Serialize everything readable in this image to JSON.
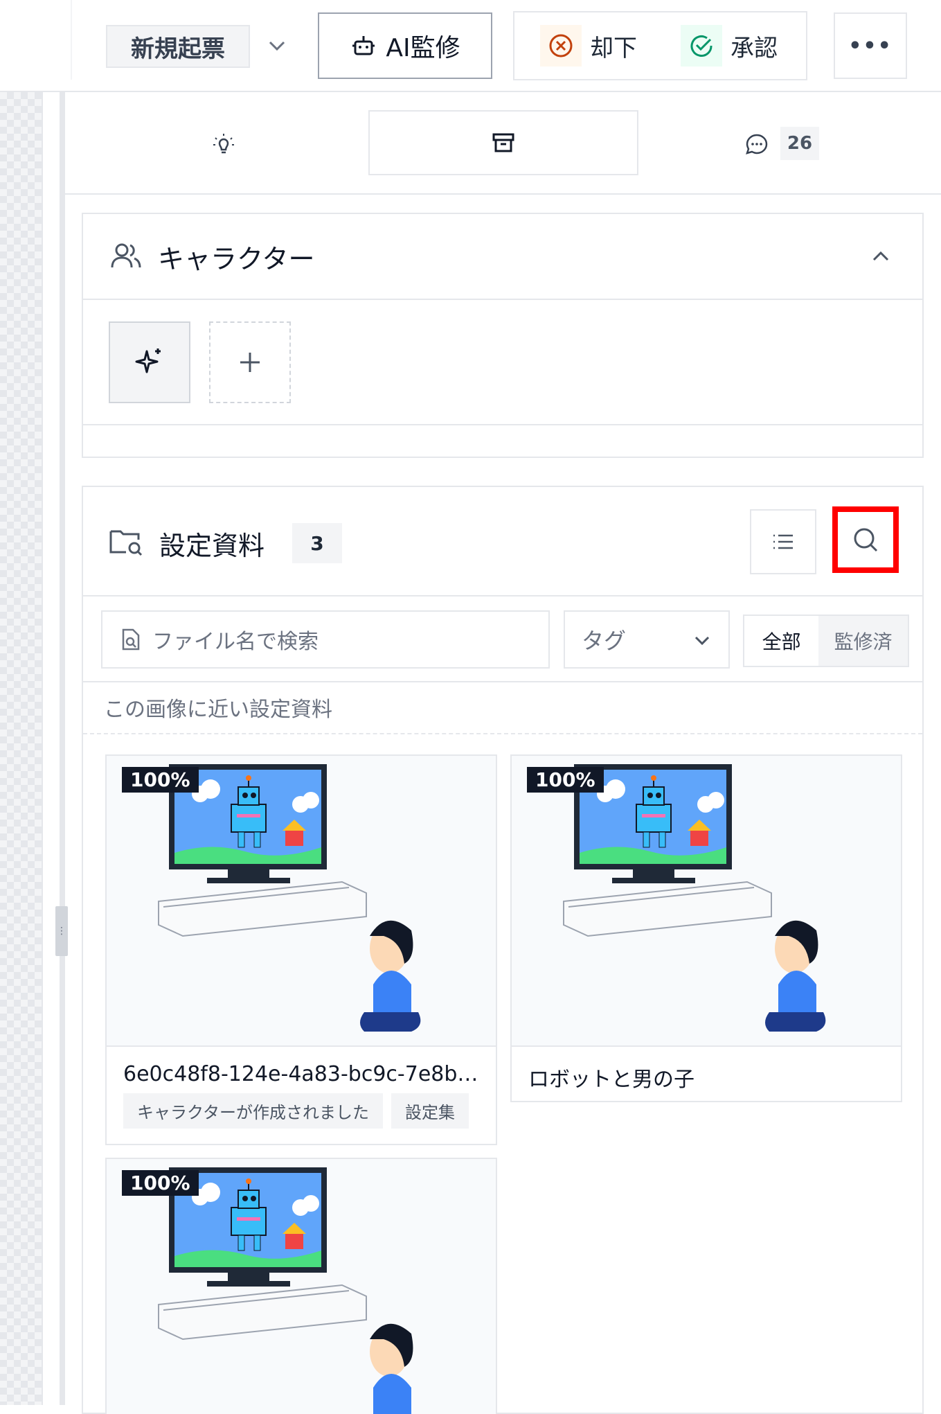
{
  "toolbar": {
    "draft_label": "新規起票",
    "ai_review_label": "AI監修",
    "reject_label": "却下",
    "approve_label": "承認",
    "more_label": "…"
  },
  "tabs": {
    "comment_count": "26"
  },
  "character_section": {
    "title": "キャラクター"
  },
  "settings_section": {
    "title": "設定資料",
    "count": "3",
    "search": {
      "placeholder": "ファイル名で検索",
      "value": ""
    },
    "tag_select": "タグ",
    "filter": [
      "全部",
      "監修済"
    ],
    "similar_caption": "この画像に近い設定資料",
    "cards": [
      {
        "percent": "100%",
        "name": "6e0c48f8-124e-4a83-bc9c-7e8b…",
        "tags": [
          "キャラクターが作成されました",
          "設定集"
        ]
      },
      {
        "percent": "100%",
        "name": "ロボットと男の子",
        "tags": []
      },
      {
        "percent": "100%",
        "name": "",
        "tags": []
      }
    ]
  },
  "colors": {
    "border": "#e5e7eb",
    "reject": "#c2410c",
    "approve": "#059669",
    "highlight": "#ff0000",
    "badge_bg": "#111827"
  }
}
